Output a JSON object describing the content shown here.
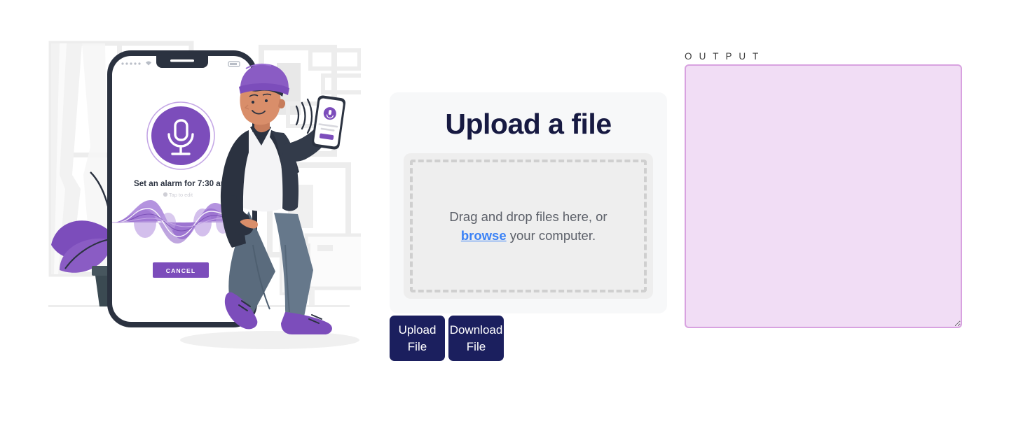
{
  "illustration": {
    "name": "voice-assistant-illustration",
    "alt": "Person with purple beanie holding a phone next to a large smartphone showing a voice assistant",
    "phone_screen": {
      "mic_icon": "microphone-icon",
      "transcript": "Set an alarm for 7:30 am",
      "hint": "Tap to edit",
      "cancel_label": "CANCEL"
    },
    "colors": {
      "purple": "#7c4dbb",
      "purple_light": "#9b6fd4",
      "phone_frame": "#2b3240",
      "jacket": "#2b3240",
      "jeans": "#5a6b7d",
      "skin": "#d98e6a",
      "pot": "#47565e",
      "background": "#f0f0f0"
    }
  },
  "upload": {
    "title": "Upload a file",
    "dropzone": {
      "text_before": "Drag and drop files here, or ",
      "link": "browse",
      "text_after": " your computer."
    }
  },
  "buttons": [
    {
      "label": "Upload File",
      "name": "upload-file-button"
    },
    {
      "label": "Download File",
      "name": "download-file-button"
    }
  ],
  "output": {
    "label": "O U T P U T",
    "value": "",
    "placeholder": ""
  },
  "theme": {
    "navy": "#1b1f5e",
    "heading": "#171a42",
    "link": "#3b82f6",
    "card_bg": "#f7f8f9",
    "dropzone_bg": "#eeeeee",
    "dash_border": "#cfcfcf",
    "output_bg": "#f1ddf5",
    "output_border": "#d8a2e0"
  }
}
